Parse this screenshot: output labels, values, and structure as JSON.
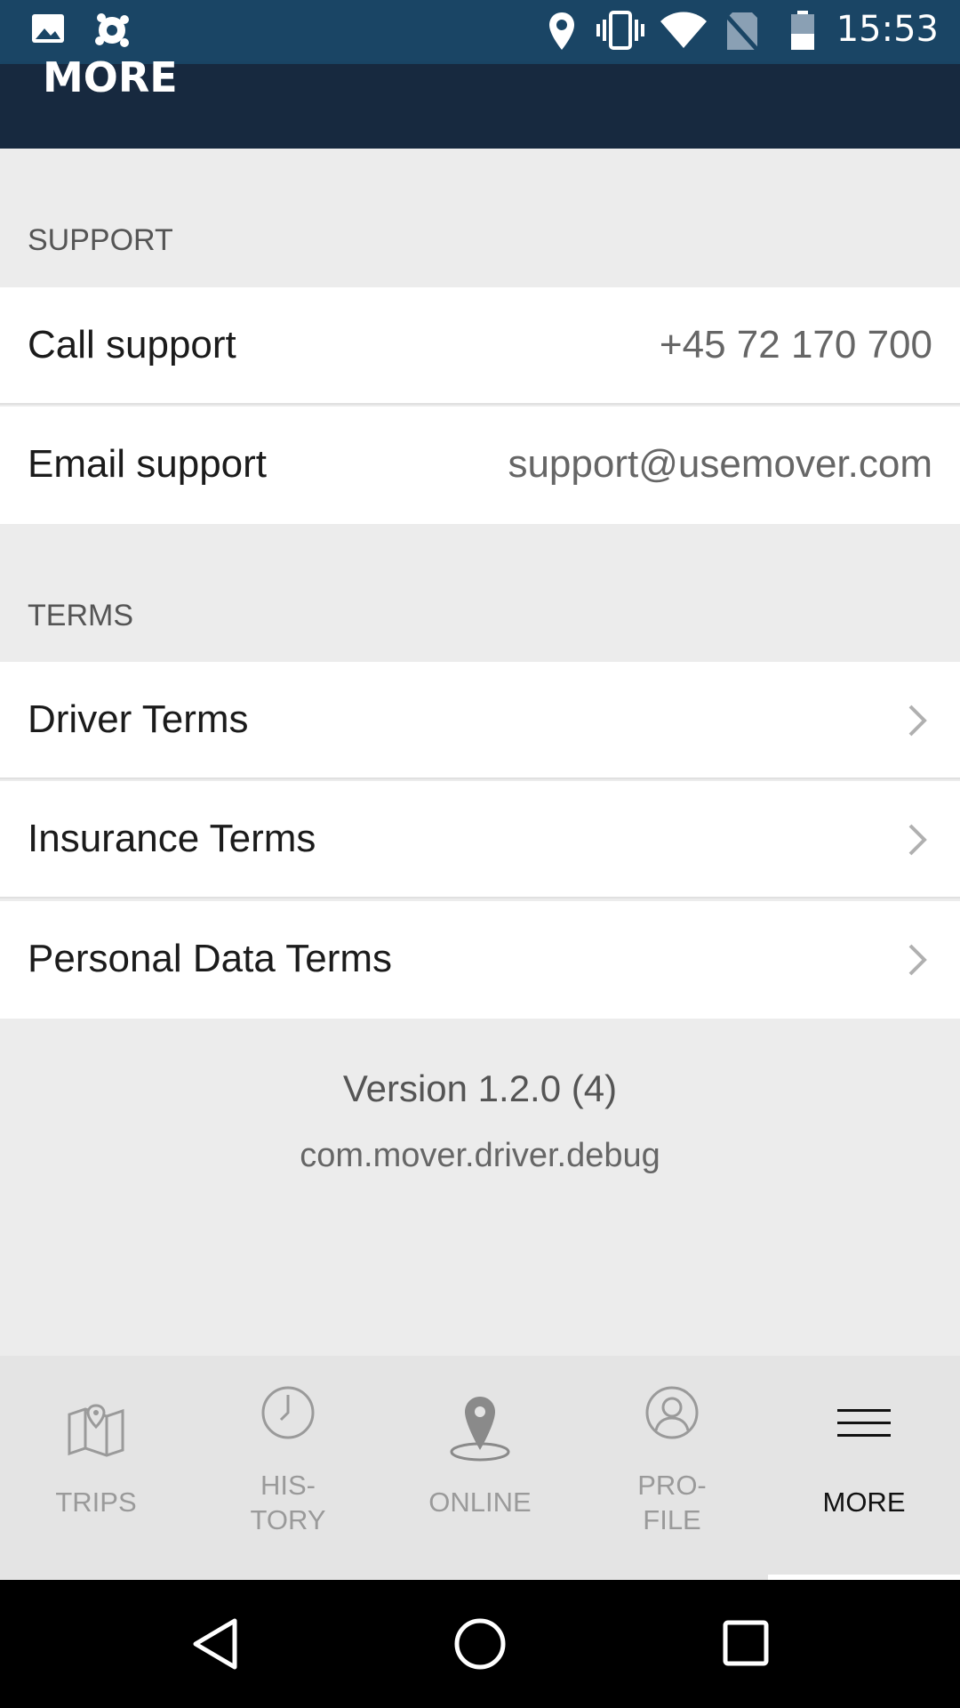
{
  "status_bar": {
    "time": "15:53",
    "icons": [
      "image-icon",
      "settings-icon",
      "location-icon",
      "vibrate-icon",
      "wifi-icon",
      "no-sim-icon",
      "battery-icon"
    ]
  },
  "header": {
    "title": "MORE"
  },
  "support": {
    "section_title": "SUPPORT",
    "call_label": "Call support",
    "call_value": "+45 72 170 700",
    "email_label": "Email support",
    "email_value": "support@usemover.com"
  },
  "terms": {
    "section_title": "TERMS",
    "items": [
      {
        "label": "Driver Terms"
      },
      {
        "label": "Insurance Terms"
      },
      {
        "label": "Personal Data Terms"
      }
    ]
  },
  "version": {
    "version_text": "Version 1.2.0 (4)",
    "package_text": "com.mover.driver.debug"
  },
  "bottom_nav": {
    "items": [
      {
        "label": "TRIPS",
        "icon": "map-icon"
      },
      {
        "label_line1": "HIS-",
        "label_line2": "TORY",
        "icon": "clock-icon"
      },
      {
        "label": "ONLINE",
        "icon": "location-pin-icon"
      },
      {
        "label_line1": "PRO-",
        "label_line2": "FILE",
        "icon": "profile-icon"
      },
      {
        "label": "MORE",
        "icon": "hamburger-icon",
        "active": true
      }
    ]
  },
  "colors": {
    "status_bar": "#1a4565",
    "header": "#17293f",
    "background": "#ececec"
  }
}
